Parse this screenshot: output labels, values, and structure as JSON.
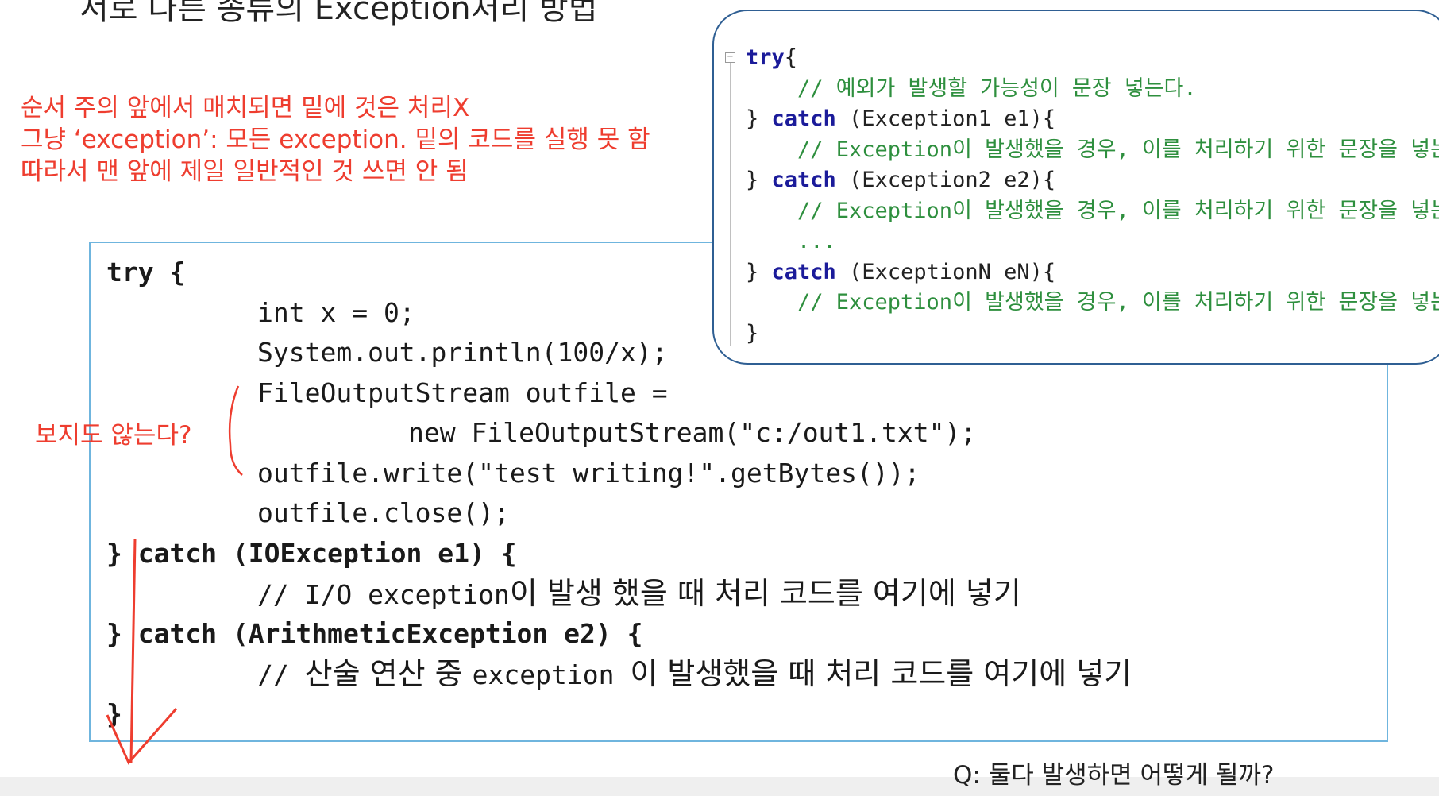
{
  "slide": {
    "title": "서로 다른 종류의 Exception처리 방법"
  },
  "notes": {
    "line1": "순서 주의 앞에서 매치되면 밑에 것은 처리X",
    "line2": "그냥 ‘exception’: 모든 exception. 밑의 코드를 실행 못 함",
    "line3": "따라서 맨 앞에 제일 일반적인 것 쓰면 안 됨"
  },
  "side_note": "보지도 않는다?",
  "question": "Q: 둘다 발생하면 어떻게 될까?",
  "main_code": {
    "l1": "try {",
    "l2": "int x = 0;",
    "l3": "System.out.println(100/x);",
    "l4": "FileOutputStream outfile =",
    "l5": "new FileOutputStream(\"c:/out1.txt\");",
    "l6": "outfile.write(\"test writing!\".getBytes());",
    "l7": "outfile.close();",
    "l8": "} catch (IOException e1) {",
    "l9_prefix": "// I/O exception",
    "l9_kr": "이 발생 했을 때 처리 코드를 여기에 넣기",
    "l10": "} catch (ArithmeticException e2) {",
    "l11_a": "// ",
    "l11_kr1": "산술 연산 중 ",
    "l11_mid": "exception ",
    "l11_kr2": "이 발생했을 때 처리 코드를 여기에 넣기",
    "l12": "}"
  },
  "example_code": {
    "try_kw": "try",
    "brace_open": "{",
    "c1": "// 예외가 발생할 가능성이 문장 넣는다.",
    "close": "} ",
    "catch_kw": "catch",
    "e1": " (Exception1 e1)",
    "cmt": "// Exception이 발생했을 경우, 이를 처리하기 위한 문장을 넣는다.",
    "e2": " (Exception2 e2)",
    "dots": "...",
    "eN": " (ExceptionN eN)",
    "end": "}"
  },
  "colors": {
    "annotation": "#ee3d2f",
    "box_border": "#6fb5de",
    "example_border": "#2f5f93",
    "keyword": "#1b1b9a",
    "comment": "#2e8f3e"
  }
}
